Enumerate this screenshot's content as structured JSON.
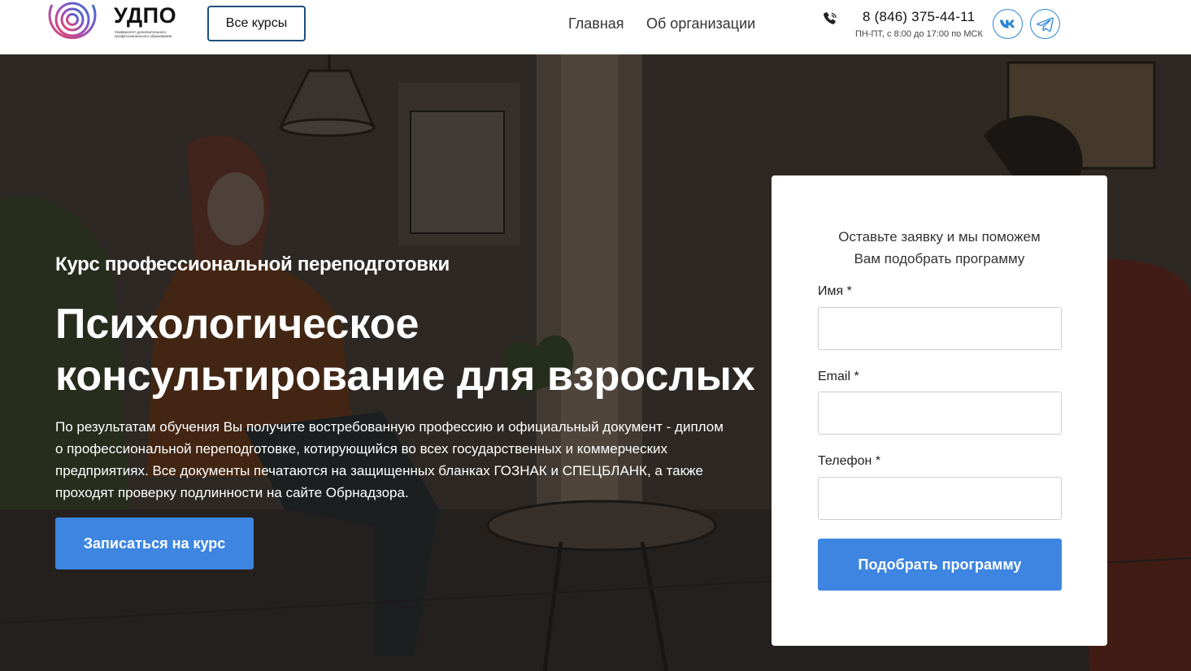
{
  "header": {
    "logo_title": "УДПО",
    "logo_subtitle": "Университет дополнительного профессионального образования",
    "all_courses_label": "Все курсы",
    "nav": [
      {
        "label": "Главная"
      },
      {
        "label": "Об организации"
      }
    ],
    "phone": "8 (846) 375-44-11",
    "hours": "ПН-ПТ, с 8:00 до 17:00 по МСК",
    "social": [
      {
        "icon": "vk-icon",
        "label": "VK"
      },
      {
        "icon": "telegram-icon"
      }
    ]
  },
  "hero": {
    "subtitle": "Курс профессиональной переподготовки",
    "title_line1": "Психологическое",
    "title_line2": "консультирование для взрослых",
    "description": "По результатам обучения Вы получите востребованную профессию и официальный документ - диплом о профессиональной переподготовке, котирующийся во всех государственных и коммерческих предприятиях. Все документы печатаются на защищенных бланках ГОЗНАК и СПЕЦБЛАНК, а также проходят проверку подлинности на сайте Обрнадзора.",
    "cta_label": "Записаться на курс"
  },
  "form": {
    "lead_line1": "Оставьте заявку и мы поможем",
    "lead_line2": "Вам подобрать программу",
    "fields": [
      {
        "label": "Имя *",
        "value": ""
      },
      {
        "label": "Email *",
        "value": ""
      },
      {
        "label": "Телефон *",
        "value": ""
      }
    ],
    "submit_label": "Подобрать программу"
  },
  "colors": {
    "accent": "#3d85e0",
    "button_border": "#1d4f7c",
    "social": "#2a86d5"
  }
}
